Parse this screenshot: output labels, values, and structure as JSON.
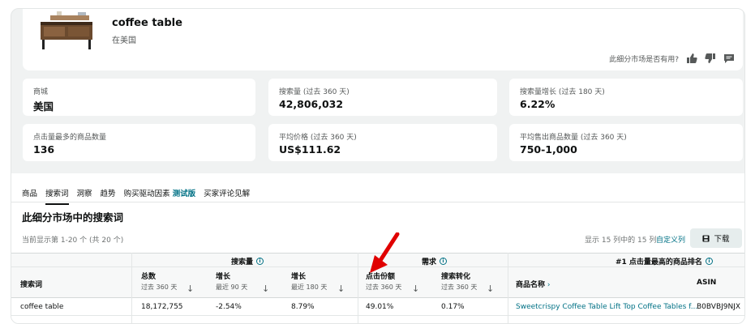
{
  "product": {
    "title": "coffee table",
    "subtitle": "在美国"
  },
  "feedback": {
    "question": "此细分市场是否有用?",
    "icons": [
      "thumbs-up-icon",
      "thumbs-down-icon",
      "comment-icon"
    ]
  },
  "stats": [
    {
      "label": "商城",
      "value": "美国"
    },
    {
      "label": "搜索量 (过去 360 天)",
      "value": "42,806,032"
    },
    {
      "label": "搜索量增长 (过去 180 天)",
      "value": "6.22%"
    },
    {
      "label": "点击量最多的商品数量",
      "value": "136"
    },
    {
      "label": "平均价格 (过去 360 天)",
      "value": "US$111.62"
    },
    {
      "label": "平均售出商品数量 (过去 360 天)",
      "value": "750-1,000"
    }
  ],
  "tabs": [
    "商品",
    "搜索词",
    "洞察",
    "趋势",
    "购买驱动因素",
    "测试版",
    "买家评论见解"
  ],
  "section": {
    "title": "此细分市场中的搜索词",
    "showing": "当前显示第 1-20 个 (共 20 个)",
    "columns_info": "显示 15 列中的 15 列",
    "customize": "自定义列",
    "download": "下载"
  },
  "table": {
    "groups": {
      "search_volume": "搜索量",
      "demand": "需求",
      "top_clicked": "#1 点击量最高的商品排名"
    },
    "headers": {
      "term": "搜索词",
      "total": "总数",
      "total_sub": "过去 360 天",
      "growth90": "增长",
      "growth90_sub": "最近 90 天",
      "growth180": "增长",
      "growth180_sub": "最近 180 天",
      "click_share": "点击份额",
      "click_share_sub": "过去 360 天",
      "conversion": "搜索转化",
      "conversion_sub": "过去 360 天",
      "product_name": "商品名称",
      "asin": "ASIN"
    },
    "rows": [
      {
        "term": "coffee table",
        "total": "18,172,755",
        "growth90": "-2.54%",
        "growth180": "8.79%",
        "click_share": "49.01%",
        "conversion": "0.17%",
        "product_name": "Sweetcrispy Coffee Table Lift Top Coffee Tables f...",
        "asin": "B0BVBJ9NJX"
      }
    ]
  },
  "colors": {
    "link": "#007185",
    "annotation_arrow": "#e00000"
  }
}
